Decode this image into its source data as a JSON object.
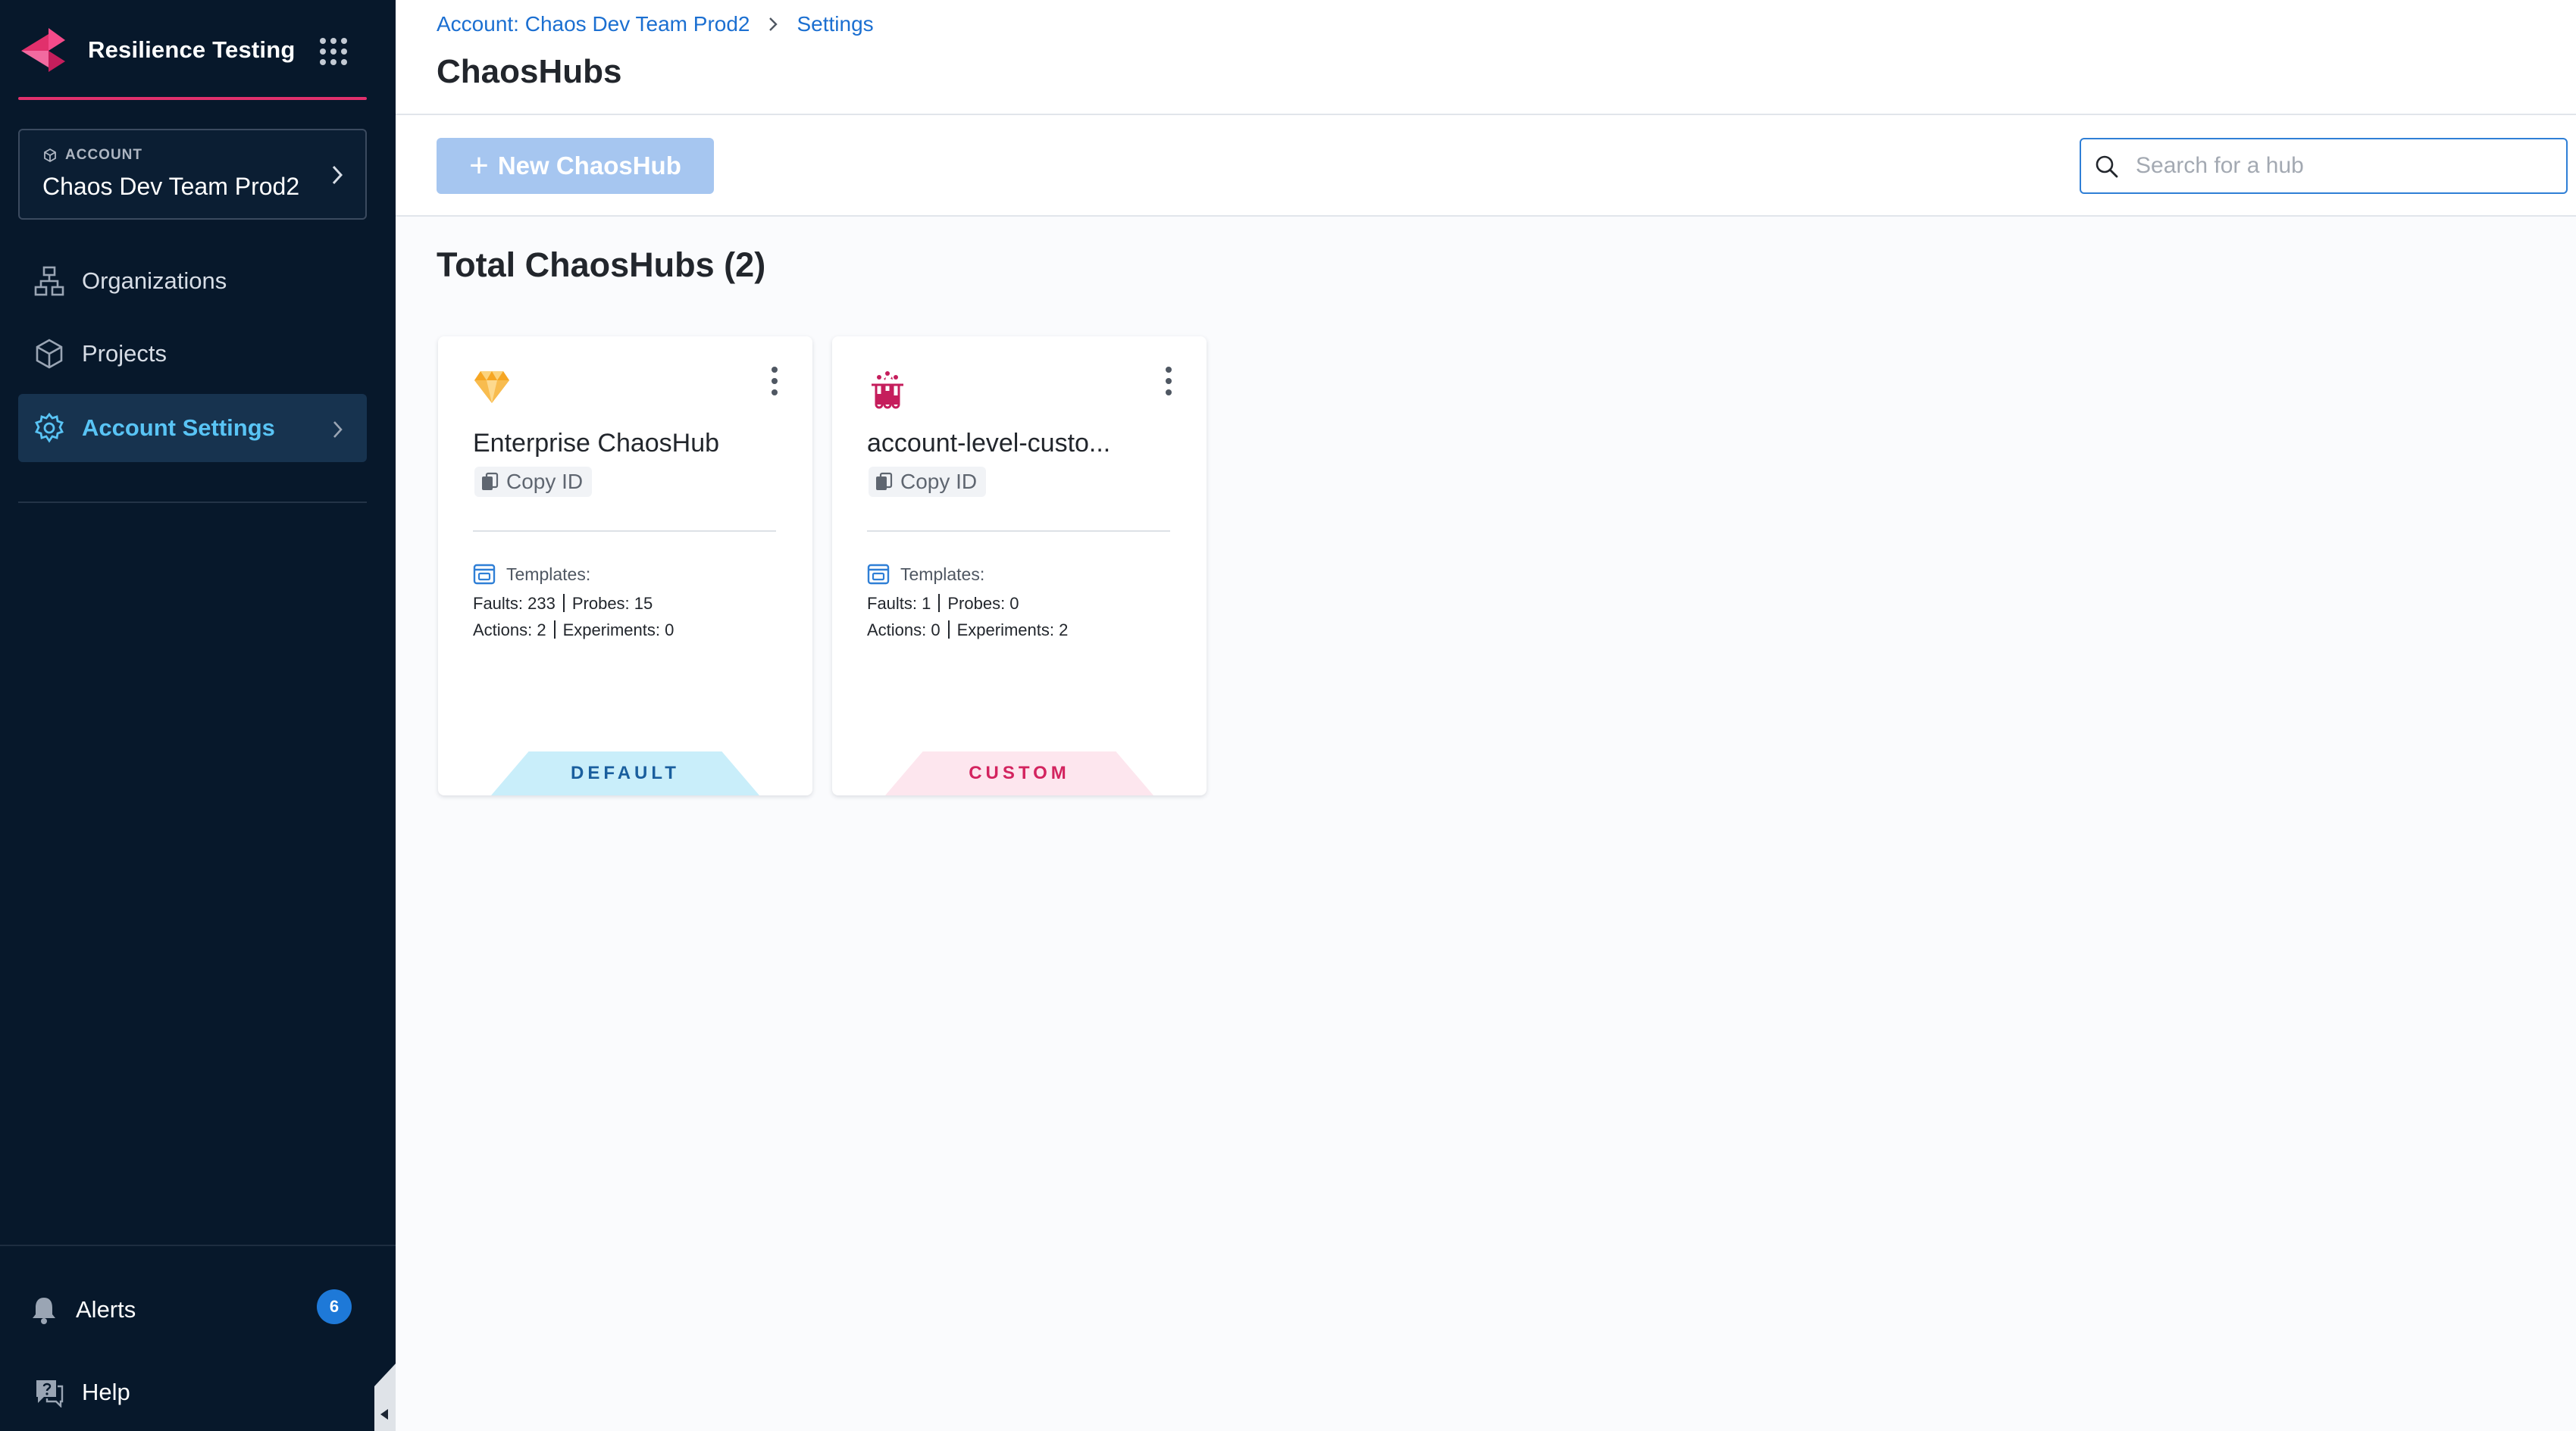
{
  "app": {
    "name": "Resilience Testing"
  },
  "account": {
    "label": "ACCOUNT",
    "name": "Chaos Dev Team Prod2"
  },
  "nav": [
    {
      "label": "Organizations",
      "icon": "organizations-icon",
      "active": false
    },
    {
      "label": "Projects",
      "icon": "projects-icon",
      "active": false
    },
    {
      "label": "Account Settings",
      "icon": "gear-icon",
      "active": true
    }
  ],
  "bottom": {
    "alerts": {
      "label": "Alerts",
      "count": "6"
    },
    "help": {
      "label": "Help"
    }
  },
  "breadcrumb": [
    {
      "label": "Account: Chaos Dev Team Prod2"
    },
    {
      "label": "Settings"
    }
  ],
  "page": {
    "title": "ChaosHubs"
  },
  "toolbar": {
    "new_label": "New ChaosHub",
    "search_placeholder": "Search for a hub",
    "search_value": ""
  },
  "section": {
    "title": "Total ChaosHubs (2)"
  },
  "hubs": [
    {
      "name": "Enterprise ChaosHub",
      "copy_label": "Copy ID",
      "templates_label": "Templates:",
      "faults": "Faults: 233",
      "probes": "Probes: 15",
      "actions": "Actions: 2",
      "experiments": "Experiments: 0",
      "tag": "DEFAULT",
      "icon": "diamond-icon"
    },
    {
      "name": "account-level-custo...",
      "copy_label": "Copy ID",
      "templates_label": "Templates:",
      "faults": "Faults: 1",
      "probes": "Probes: 0",
      "actions": "Actions: 0",
      "experiments": "Experiments: 2",
      "tag": "CUSTOM",
      "icon": "test-tubes-icon"
    }
  ],
  "colors": {
    "sidebar_bg": "#07182b",
    "accent": "#e1306c",
    "link": "#1b6fd1",
    "active_nav": "#59c4f5",
    "button_disabled": "#a6c6f0",
    "badge": "#1e79d8"
  }
}
